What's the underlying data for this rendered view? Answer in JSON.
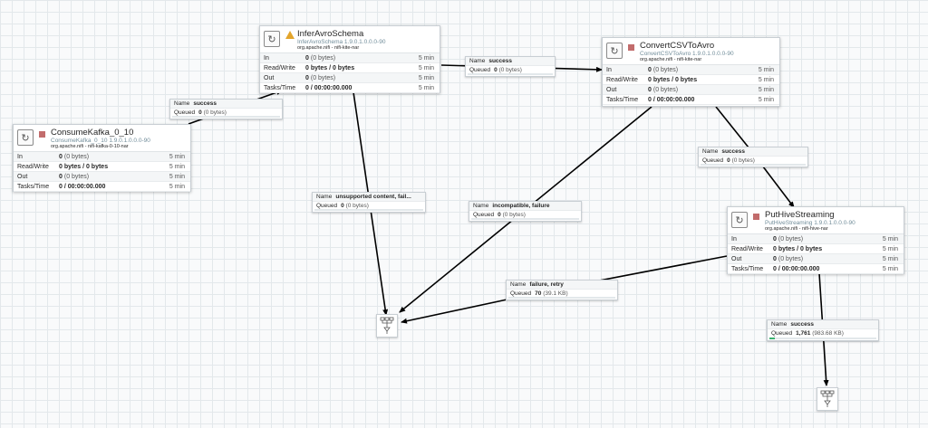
{
  "processors": {
    "consume": {
      "name": "ConsumeKafka_0_10",
      "type": "ConsumeKafka_0_10 1.9.0.1.0.0.0-90",
      "bundle": "org.apache.nifi - nifi-kafka-0-10-nar",
      "status_icon": "stopped-icon",
      "stats": [
        {
          "label": "In",
          "value": "0",
          "sub": "(0 bytes)",
          "time": "5 min"
        },
        {
          "label": "Read/Write",
          "value": "0 bytes / 0 bytes",
          "sub": "",
          "time": "5 min"
        },
        {
          "label": "Out",
          "value": "0",
          "sub": "(0 bytes)",
          "time": "5 min"
        },
        {
          "label": "Tasks/Time",
          "value": "0 / 00:00:00.000",
          "sub": "",
          "time": "5 min"
        }
      ]
    },
    "infer": {
      "name": "InferAvroSchema",
      "type": "InferAvroSchema 1.9.0.1.0.0.0-90",
      "bundle": "org.apache.nifi - nifi-kite-nar",
      "status_icon": "warning-icon",
      "stats": [
        {
          "label": "In",
          "value": "0",
          "sub": "(0 bytes)",
          "time": "5 min"
        },
        {
          "label": "Read/Write",
          "value": "0 bytes / 0 bytes",
          "sub": "",
          "time": "5 min"
        },
        {
          "label": "Out",
          "value": "0",
          "sub": "(0 bytes)",
          "time": "5 min"
        },
        {
          "label": "Tasks/Time",
          "value": "0 / 00:00:00.000",
          "sub": "",
          "time": "5 min"
        }
      ]
    },
    "convert": {
      "name": "ConvertCSVToAvro",
      "type": "ConvertCSVToAvro 1.9.0.1.0.0.0-90",
      "bundle": "org.apache.nifi - nifi-kite-nar",
      "status_icon": "stopped-icon",
      "stats": [
        {
          "label": "In",
          "value": "0",
          "sub": "(0 bytes)",
          "time": "5 min"
        },
        {
          "label": "Read/Write",
          "value": "0 bytes / 0 bytes",
          "sub": "",
          "time": "5 min"
        },
        {
          "label": "Out",
          "value": "0",
          "sub": "(0 bytes)",
          "time": "5 min"
        },
        {
          "label": "Tasks/Time",
          "value": "0 / 00:00:00.000",
          "sub": "",
          "time": "5 min"
        }
      ]
    },
    "puthive": {
      "name": "PutHiveStreaming",
      "type": "PutHiveStreaming 1.9.0.1.0.0.0-90",
      "bundle": "org.apache.nifi - nifi-hive-nar",
      "status_icon": "stopped-icon",
      "stats": [
        {
          "label": "In",
          "value": "0",
          "sub": "(0 bytes)",
          "time": "5 min"
        },
        {
          "label": "Read/Write",
          "value": "0 bytes / 0 bytes",
          "sub": "",
          "time": "5 min"
        },
        {
          "label": "Out",
          "value": "0",
          "sub": "(0 bytes)",
          "time": "5 min"
        },
        {
          "label": "Tasks/Time",
          "value": "0 / 00:00:00.000",
          "sub": "",
          "time": "5 min"
        }
      ]
    }
  },
  "connections": {
    "name_key": "Name",
    "queued_key": "Queued",
    "c1": {
      "name": "success",
      "queued": "0",
      "queued_sub": "(0 bytes)",
      "fill": 0
    },
    "c2": {
      "name": "success",
      "queued": "0",
      "queued_sub": "(0 bytes)",
      "fill": 0
    },
    "c3": {
      "name": "unsupported content, fail...",
      "queued": "0",
      "queued_sub": "(0 bytes)",
      "fill": 0
    },
    "c4": {
      "name": "success",
      "queued": "0",
      "queued_sub": "(0 bytes)",
      "fill": 0
    },
    "c5": {
      "name": "incompatible, failure",
      "queued": "0",
      "queued_sub": "(0 bytes)",
      "fill": 0
    },
    "c6": {
      "name": "failure, retry",
      "queued": "70",
      "queued_sub": "(39.1 KB)",
      "fill": 0
    },
    "c7": {
      "name": "success",
      "queued": "1,761",
      "queued_sub": "(983.68 KB)",
      "fill": 0.05
    }
  },
  "funnels": {
    "f1": {
      "icon": "funnel-icon"
    },
    "f2": {
      "icon": "funnel-icon"
    }
  },
  "colors": {
    "stopped": "#c26c6c",
    "warning": "#e3a52c",
    "edge": "#000000",
    "queue_fill": "#3cb371"
  }
}
